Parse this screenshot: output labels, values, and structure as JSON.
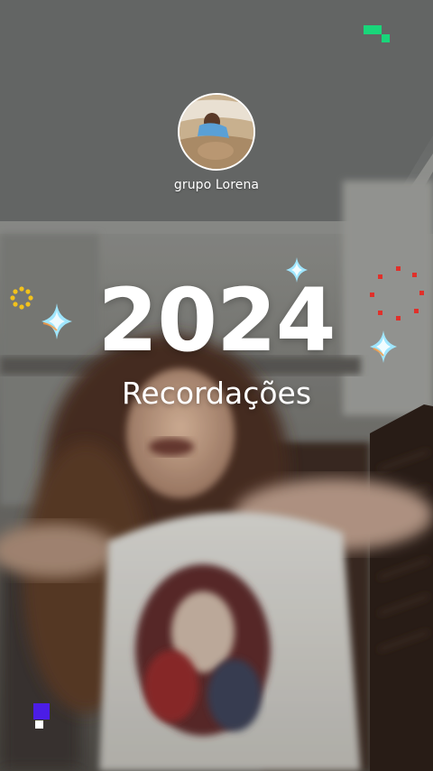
{
  "story": {
    "group_name": "grupo Lorena",
    "year": "2024",
    "subtitle": "Recordações"
  },
  "icons": {
    "corner_mark_top": "pixel-blocks-icon",
    "corner_mark_bottom": "pixel-blocks-icon",
    "sparkles": "sparkle-icon",
    "sun_dots": "dotted-sun-icon",
    "firework": "firework-icon"
  },
  "colors": {
    "text": "#ffffff",
    "pixel_green": "#19d67a",
    "pixel_blue": "#4b1de6",
    "sun_yellow": "#f2c21b",
    "firework_red": "#e0302a",
    "sparkle_cyan": "#9fe6ff"
  }
}
